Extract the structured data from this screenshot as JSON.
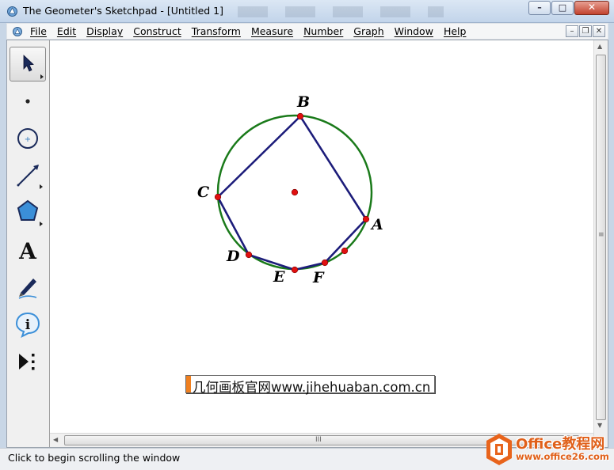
{
  "window": {
    "title": "The Geometer's Sketchpad - [Untitled 1]",
    "minimize_symbol": "–",
    "maximize_symbol": "□",
    "close_symbol": "✕"
  },
  "menu": {
    "items": [
      "File",
      "Edit",
      "Display",
      "Construct",
      "Transform",
      "Measure",
      "Number",
      "Graph",
      "Window",
      "Help"
    ],
    "mdi_minimize": "–",
    "mdi_restore": "❐",
    "mdi_close": "✕"
  },
  "toolbox": {
    "tools": [
      {
        "name": "selection-arrow-tool",
        "icon": "arrow-icon",
        "active": true
      },
      {
        "name": "point-tool",
        "icon": "point-icon",
        "active": false
      },
      {
        "name": "compass-tool",
        "icon": "circle-icon",
        "active": false
      },
      {
        "name": "straightedge-tool",
        "icon": "segment-icon",
        "active": false
      },
      {
        "name": "polygon-tool",
        "icon": "polygon-icon",
        "active": false
      },
      {
        "name": "text-tool",
        "icon": "text-A-icon",
        "active": false
      },
      {
        "name": "marker-tool",
        "icon": "marker-pen-icon",
        "active": false
      },
      {
        "name": "information-tool",
        "icon": "info-icon",
        "active": false
      },
      {
        "name": "custom-tool",
        "icon": "custom-tools-icon",
        "active": false
      }
    ],
    "text_tool_glyph": "A",
    "info_tool_glyph": "i"
  },
  "sketch": {
    "circle_color": "#1a7a1a",
    "polygon_color": "#1c1c7a",
    "point_color": "#e01010",
    "labels": {
      "A": "A",
      "B": "B",
      "C": "C",
      "D": "D",
      "E": "E",
      "F": "F"
    }
  },
  "caption_box": {
    "text": "几何画板官网www.jihehuaban.com.cn",
    "accent": "#f08020"
  },
  "scrollbars": {
    "h_grip": "III",
    "v_grip": "≡"
  },
  "status": {
    "text": "Click to begin scrolling the window"
  },
  "watermark": {
    "title": "Office教程网",
    "url": "www.office26.com",
    "color": "#e0601a"
  }
}
